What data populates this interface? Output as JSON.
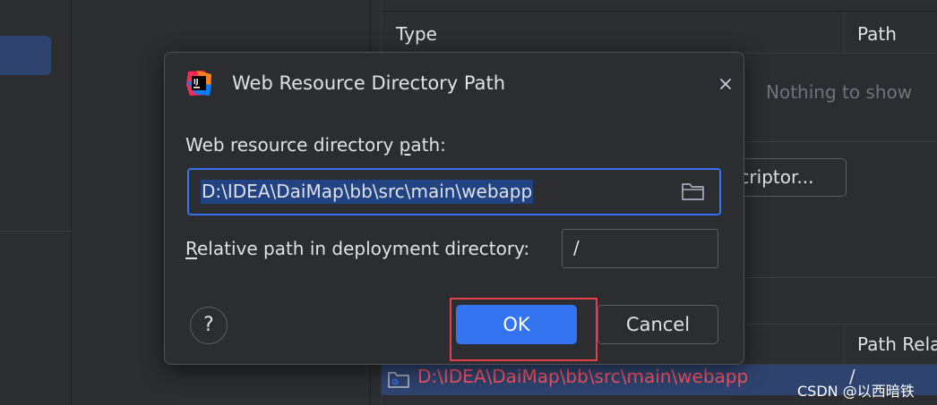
{
  "background": {
    "table": {
      "columns": [
        "Type",
        "Path"
      ],
      "empty_text": "Nothing to show",
      "descriptor_button_label": "scriptor..."
    },
    "second_table": {
      "column_partial": "Path Rela",
      "selected_row": {
        "path": "D:\\IDEA\\DaiMap\\bb\\src\\main\\webapp",
        "relative_path": "/"
      }
    },
    "watermark": "CSDN @以西暗铁"
  },
  "dialog": {
    "title": "Web Resource Directory Path",
    "path_label_prefix": "Web resource directory ",
    "path_label_mnemonic": "p",
    "path_label_suffix": "ath:",
    "path_value": "D:\\IDEA\\DaiMap\\bb\\src\\main\\webapp",
    "relative_label_mnemonic": "R",
    "relative_label_suffix": "elative path in deployment directory:",
    "relative_value": "/",
    "help_label": "?",
    "ok_label": "OK",
    "cancel_label": "Cancel"
  },
  "colors": {
    "accent": "#3574f0",
    "highlight_box": "#e0424b",
    "error_path": "#f75464",
    "selection": "#214283"
  },
  "icons": [
    "intellij-logo-icon",
    "close-icon",
    "folder-icon",
    "help-icon",
    "module-folder-icon"
  ]
}
